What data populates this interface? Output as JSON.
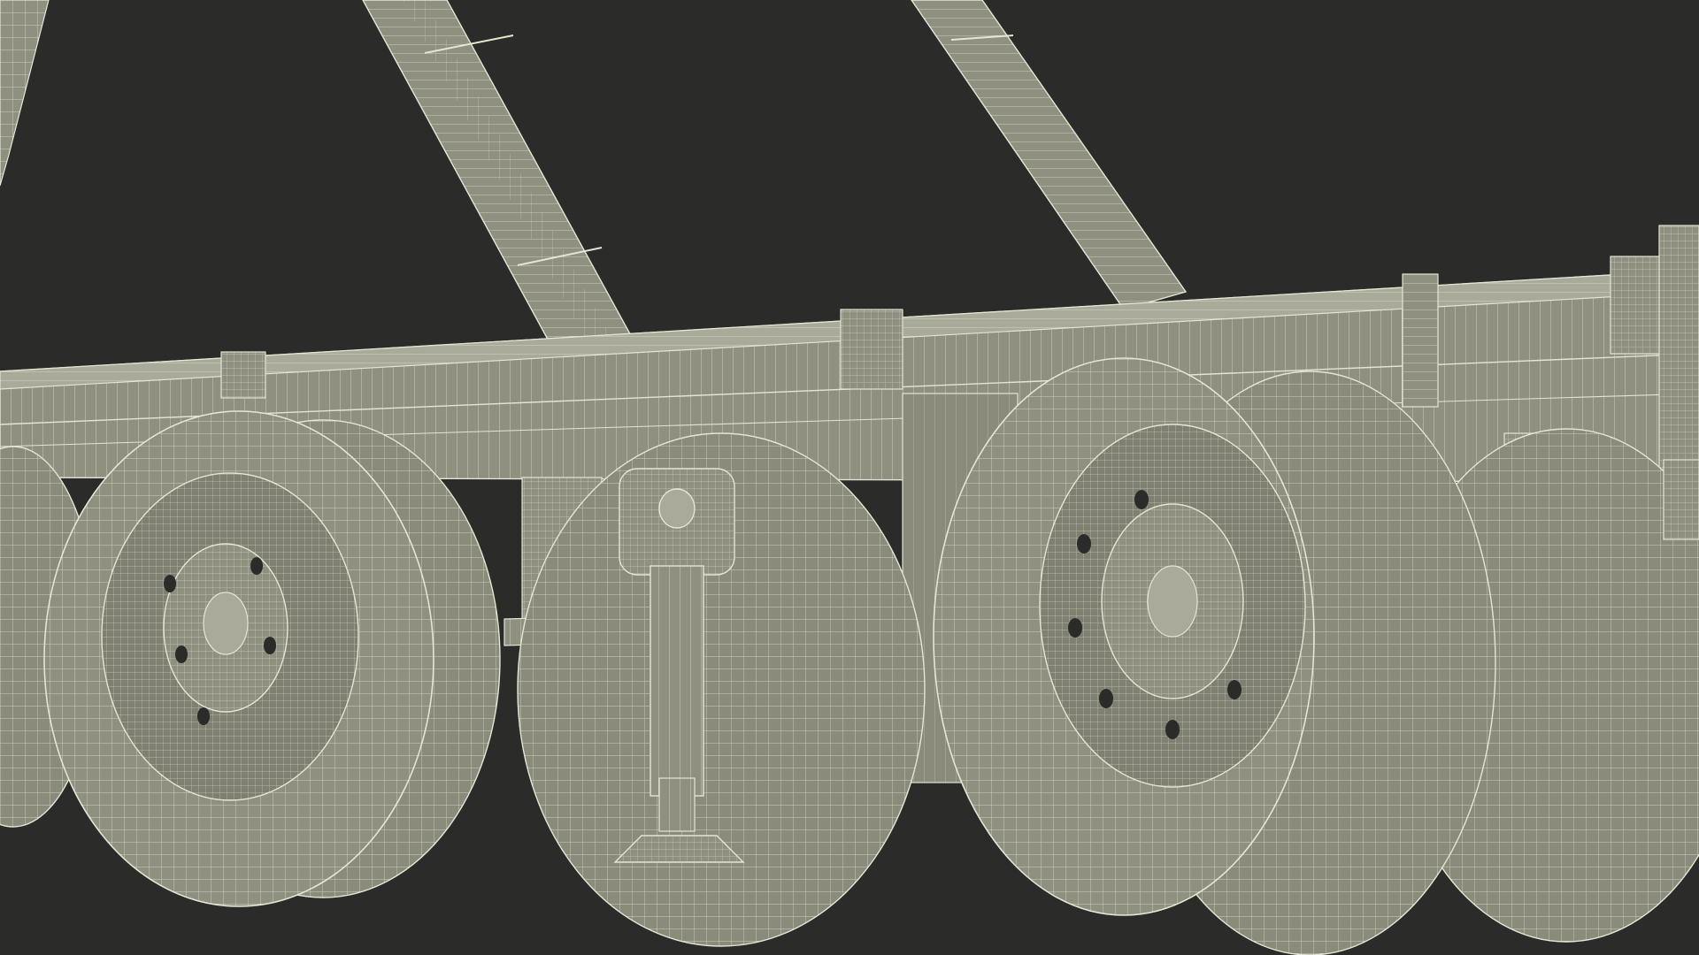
{
  "scene": {
    "subject": "wireframe-render-truck-chassis-wheels",
    "colors": {
      "background": "#2b2b29",
      "surface": "#8f9080",
      "surface_dark": "#6e6f62",
      "surface_light": "#a9aa99",
      "wire": "#e4e5d4"
    }
  }
}
